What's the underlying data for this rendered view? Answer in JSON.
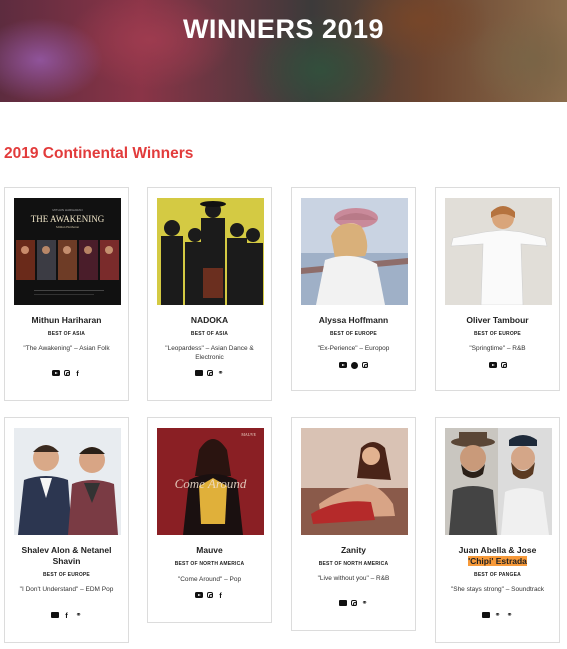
{
  "page": {
    "hero_title": "WINNERS 2019",
    "section_title": "2019 Continental Winners"
  },
  "colors": {
    "section_title": "#e23b3b",
    "highlight": "#f79a3a"
  },
  "winners": [
    {
      "name": "Mithun Hariharan",
      "category": "BEST OF ASIA",
      "song": "\"The Awakening\" – Asian Folk",
      "icons": [
        "youtube-icon",
        "instagram-icon",
        "facebook-icon"
      ],
      "album_title": "THE AWAKENING",
      "album_artist": "Mithun Hariharan",
      "album_small": "MITHUN HARIHARAN"
    },
    {
      "name": "NADOKA",
      "category": "BEST OF ASIA",
      "song": "\"Leopardess\" – Asian Dance & Electronic",
      "icons": [
        "soundcloud-icon",
        "instagram-icon",
        "link-icon"
      ]
    },
    {
      "name": "Alyssa Hoffmann",
      "category": "BEST OF EUROPE",
      "song": "\"Ex-Perience\" – Europop",
      "icons": [
        "youtube-icon",
        "spotify-icon",
        "instagram-icon"
      ]
    },
    {
      "name": "Oliver Tambour",
      "category": "BEST OF EUROPE",
      "song": "\"Springtime\" – R&B",
      "icons": [
        "youtube-icon",
        "instagram-icon"
      ]
    },
    {
      "name": "Shalev Alon & Netanel Shavin",
      "category": "BEST OF EUROPE",
      "song": "\"I Don't Understand\" – EDM Pop",
      "icons": [
        "soundcloud-icon",
        "facebook-icon",
        "link-icon"
      ]
    },
    {
      "name": "Mauve",
      "category": "BEST OF NORTH AMERICA",
      "song": "\"Come Around\" – Pop",
      "icons": [
        "youtube-icon",
        "instagram-icon",
        "facebook-icon"
      ],
      "album_title": "Come Around",
      "album_brand": "MAUVE"
    },
    {
      "name": "Zanity",
      "category": "BEST OF NORTH AMERICA",
      "song": "\"Live without you\" – R&B",
      "icons": [
        "soundcloud-icon",
        "instagram-icon",
        "link-icon"
      ]
    },
    {
      "name_line1": "Juan Abella & Jose",
      "name_line2": "'Chipi' Estrada",
      "category": "BEST OF PANGEA",
      "song": "\"She stays strong\" – Soundtrack",
      "icons": [
        "soundcloud-icon",
        "link-icon",
        "link-icon"
      ]
    }
  ]
}
